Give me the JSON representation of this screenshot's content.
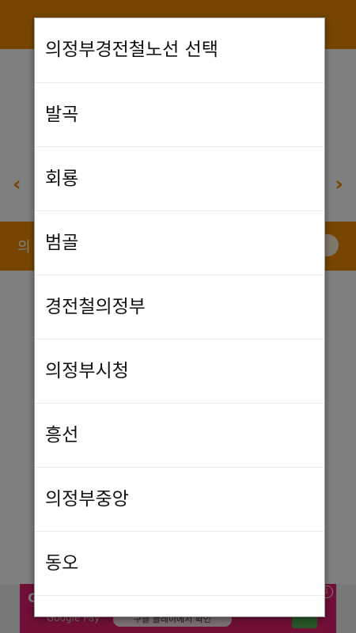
{
  "background": {
    "prev_arrow": "‹",
    "next_arrow": "›",
    "bar_text": "의",
    "ad": {
      "provider": "G",
      "gpay_label": "Google Pay",
      "cta_label": "구글 플레이에서 확인",
      "info_label": "i",
      "color": "#e21f6e"
    },
    "accent": "#ef8a00"
  },
  "dialog": {
    "title": "의정부경전철노선 선택",
    "items": [
      {
        "label": "발곡"
      },
      {
        "label": "회룡"
      },
      {
        "label": "범골"
      },
      {
        "label": "경전철의정부"
      },
      {
        "label": "의정부시청"
      },
      {
        "label": "흥선"
      },
      {
        "label": "의정부중앙"
      },
      {
        "label": "동오"
      },
      {
        "label": ""
      }
    ]
  }
}
